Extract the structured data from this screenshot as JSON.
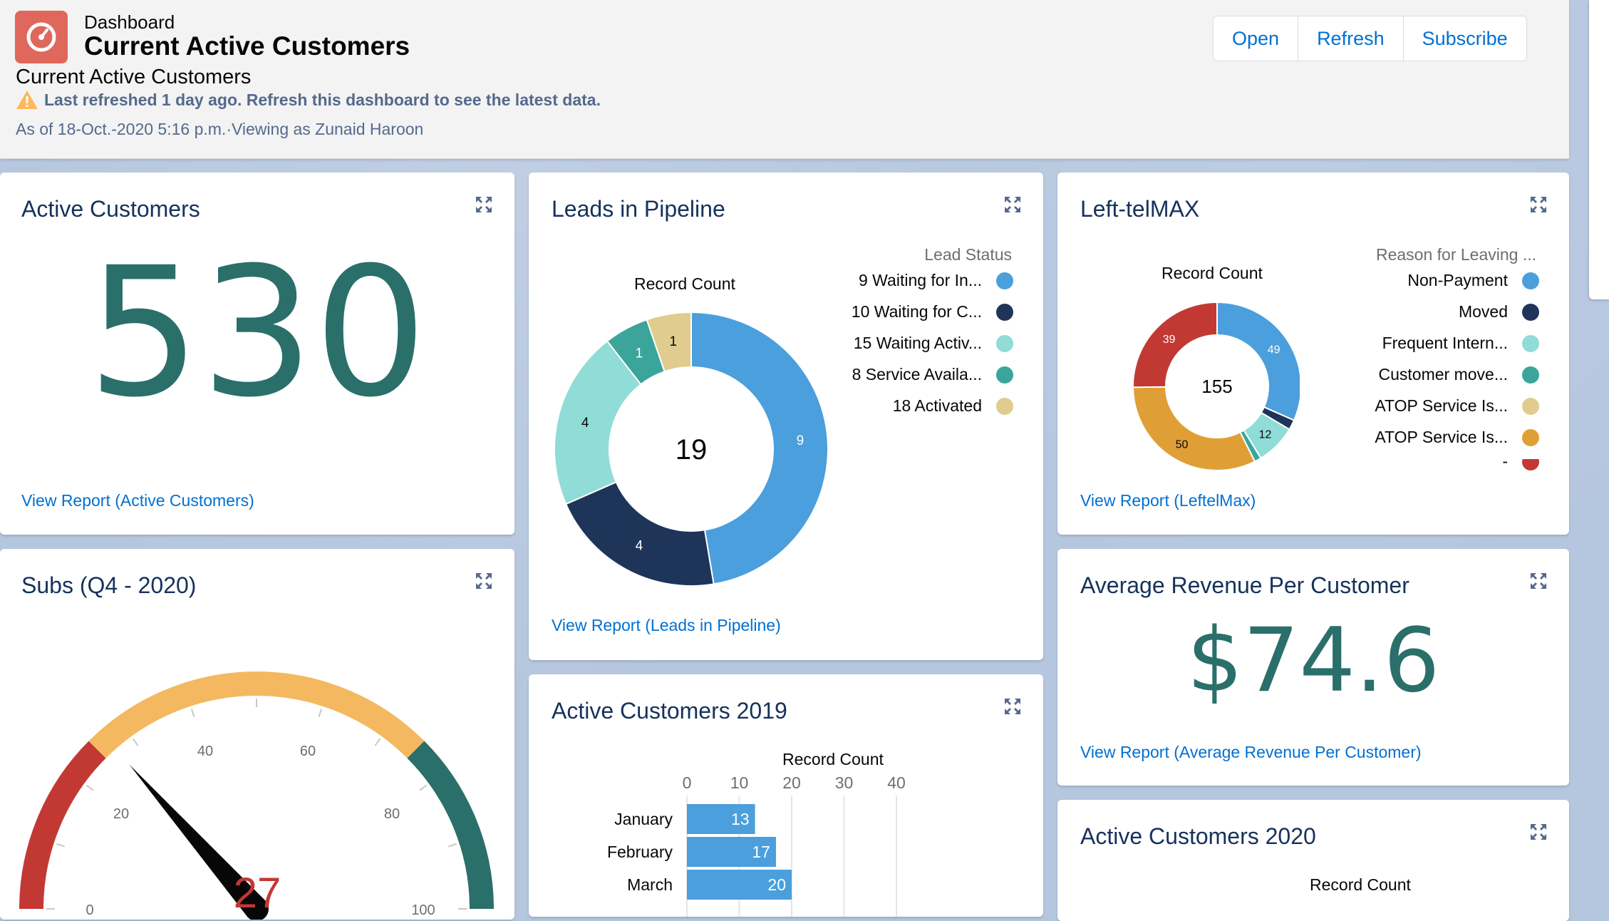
{
  "header": {
    "object_type": "Dashboard",
    "title": "Current Active Customers",
    "subtitle": "Current Active Customers",
    "warning": "Last refreshed 1 day ago. Refresh this dashboard to see the latest data.",
    "as_of": "As of 18-Oct.-2020 5:16 p.m.·Viewing as Zunaid Haroon",
    "buttons": {
      "open": "Open",
      "refresh": "Refresh",
      "subscribe": "Subscribe"
    }
  },
  "cards": {
    "active_customers": {
      "title": "Active Customers",
      "value": "530",
      "link": "View Report (Active Customers)"
    },
    "leads_pipeline": {
      "title": "Leads in Pipeline",
      "metric_label": "Record Count",
      "total": "19",
      "legend_title": "Lead Status",
      "legend": [
        {
          "label": "9 Waiting for In...",
          "color": "#4a9fdc"
        },
        {
          "label": "10 Waiting for C...",
          "color": "#1f3459"
        },
        {
          "label": "15 Waiting Activ...",
          "color": "#90dcd7"
        },
        {
          "label": "8 Service Availa...",
          "color": "#3ba59b"
        },
        {
          "label": "18 Activated",
          "color": "#e0cc8e"
        }
      ],
      "link": "View Report (Leads in Pipeline)"
    },
    "leftelmax": {
      "title": "Left-telMAX",
      "metric_label": "Record Count",
      "total": "155",
      "legend_title": "Reason for Leaving ...",
      "legend": [
        {
          "label": "Non-Payment",
          "color": "#4a9fdc"
        },
        {
          "label": "Moved",
          "color": "#1f3459"
        },
        {
          "label": "Frequent Intern...",
          "color": "#90dcd7"
        },
        {
          "label": "Customer move...",
          "color": "#3ba59b"
        },
        {
          "label": "ATOP Service Is...",
          "color": "#e0cc8e"
        },
        {
          "label": "ATOP Service Is...",
          "color": "#e09f36"
        },
        {
          "label": "-",
          "color": "#c23934"
        }
      ],
      "link": "View Report (LeftelMax)"
    },
    "subs": {
      "title": "Subs (Q4 - 2020)",
      "value": "27",
      "ticks": [
        "0",
        "20",
        "40",
        "60",
        "80",
        "100"
      ]
    },
    "arpc": {
      "title": "Average Revenue Per Customer",
      "value": "$74.6",
      "link": "View Report (Average Revenue Per Customer)"
    },
    "ac2019": {
      "title": "Active Customers 2019",
      "metric_label": "Record Count",
      "axis_ticks": [
        "0",
        "10",
        "20",
        "30",
        "40"
      ]
    },
    "ac2020": {
      "title": "Active Customers 2020",
      "metric_label": "Record Count"
    }
  },
  "chart_data": [
    {
      "type": "pie",
      "title": "Leads in Pipeline",
      "categories": [
        "9 Waiting for In...",
        "10 Waiting for C...",
        "15 Waiting Activ...",
        "8 Service Availa...",
        "18 Activated"
      ],
      "values": [
        9,
        4,
        4,
        1,
        1
      ],
      "colors": [
        "#4a9fdc",
        "#1f3459",
        "#90dcd7",
        "#3ba59b",
        "#e0cc8e"
      ]
    },
    {
      "type": "pie",
      "title": "Left-telMAX",
      "categories": [
        "Non-Payment",
        "Moved",
        "Frequent Intern...",
        "Customer move...",
        "ATOP Service Is...",
        "ATOP Service Is...",
        "-"
      ],
      "values": [
        49,
        3,
        12,
        2,
        0,
        50,
        39
      ],
      "colors": [
        "#4a9fdc",
        "#1f3459",
        "#90dcd7",
        "#3ba59b",
        "#e0cc8e",
        "#e09f36",
        "#c23934"
      ]
    },
    {
      "type": "bar",
      "title": "Active Customers 2019",
      "categories": [
        "January",
        "February",
        "March"
      ],
      "values": [
        13,
        17,
        20
      ],
      "xlabel": "Record Count",
      "xlim": [
        0,
        40
      ]
    }
  ]
}
